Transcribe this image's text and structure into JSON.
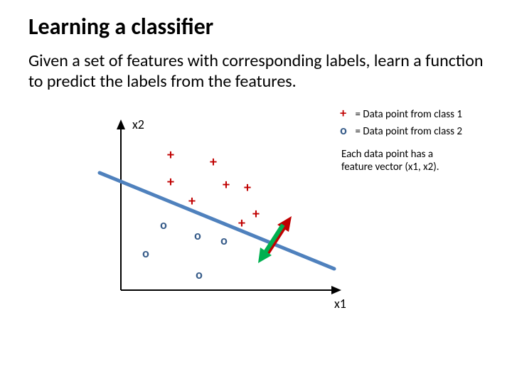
{
  "title": "Learning a classifier",
  "body": "Given a set of features with corresponding labels, learn a function to predict the labels from the features.",
  "chart_data": {
    "type": "scatter",
    "xlabel": "x1",
    "ylabel": "x2",
    "series": [
      {
        "name": "class1",
        "symbol": "+",
        "color": "#c00000",
        "points": [
          [
            0.24,
            0.76
          ],
          [
            0.42,
            0.73
          ],
          [
            0.24,
            0.61
          ],
          [
            0.34,
            0.5
          ],
          [
            0.48,
            0.6
          ],
          [
            0.58,
            0.58
          ],
          [
            0.56,
            0.39
          ],
          [
            0.62,
            0.44
          ]
        ]
      },
      {
        "name": "class2",
        "symbol": "o",
        "color": "#385d8a",
        "points": [
          [
            0.2,
            0.36
          ],
          [
            0.35,
            0.3
          ],
          [
            0.47,
            0.27
          ],
          [
            0.12,
            0.2
          ],
          [
            0.36,
            0.08
          ]
        ]
      }
    ],
    "line": {
      "x0": 0.0,
      "y0": 0.66,
      "x1": 0.95,
      "y1": 0.1,
      "color": "#4f81bd"
    },
    "arrows": [
      {
        "from": [
          0.61,
          0.24
        ],
        "to": [
          0.69,
          0.41
        ],
        "color": "#c00000"
      },
      {
        "from": [
          0.69,
          0.41
        ],
        "to": [
          0.61,
          0.24
        ],
        "color": "#00b050"
      }
    ]
  },
  "legend": {
    "class1_symbol": "+",
    "class1_text": "= Data point from class 1",
    "class2_symbol": "o",
    "class2_text": "= Data point from class 2"
  },
  "note": "Each data point has a feature vector (x1, x2)."
}
